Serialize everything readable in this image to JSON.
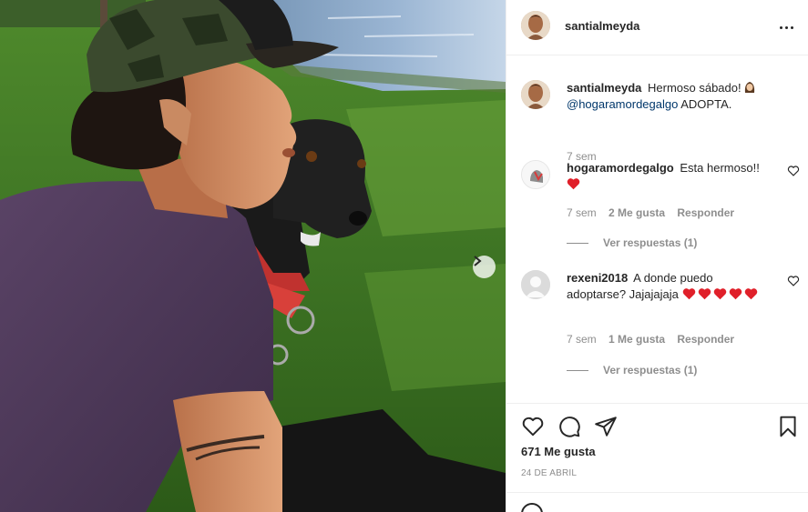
{
  "post": {
    "author": "santialmeyda",
    "more_label": "Más opciones"
  },
  "caption": {
    "username": "santialmeyda",
    "text": "Hermoso sábado!",
    "mention": "@hogaramordegalgo",
    "text_after": "ADOPTA.",
    "time": "7 sem"
  },
  "comments": [
    {
      "username": "hogaramordegalgo",
      "text": "Esta hermoso!!",
      "hearts": 1,
      "time": "7 sem",
      "likes": "2 Me gusta",
      "reply": "Responder",
      "view_replies": "Ver respuestas (1)"
    },
    {
      "username": "rexeni2018",
      "text": "A donde puedo adoptarse? Jajajajaja",
      "hearts": 5,
      "time": "7 sem",
      "likes": "1 Me gusta",
      "reply": "Responder",
      "view_replies": "Ver respuestas (1)"
    }
  ],
  "stats": {
    "likes": "671 Me gusta",
    "date": "24 DE ABRIL"
  },
  "icons": {
    "like": "heart-outline-icon",
    "comment": "speech-bubble-icon",
    "share": "paper-plane-icon",
    "save": "bookmark-icon",
    "next": "chevron-right-icon",
    "more": "ellipsis-icon",
    "emoji": "smiley-icon"
  },
  "colors": {
    "text": "#262626",
    "secondary": "#8e8e8e",
    "link": "#00376b",
    "heart": "#ed4956",
    "border": "#efefef"
  }
}
